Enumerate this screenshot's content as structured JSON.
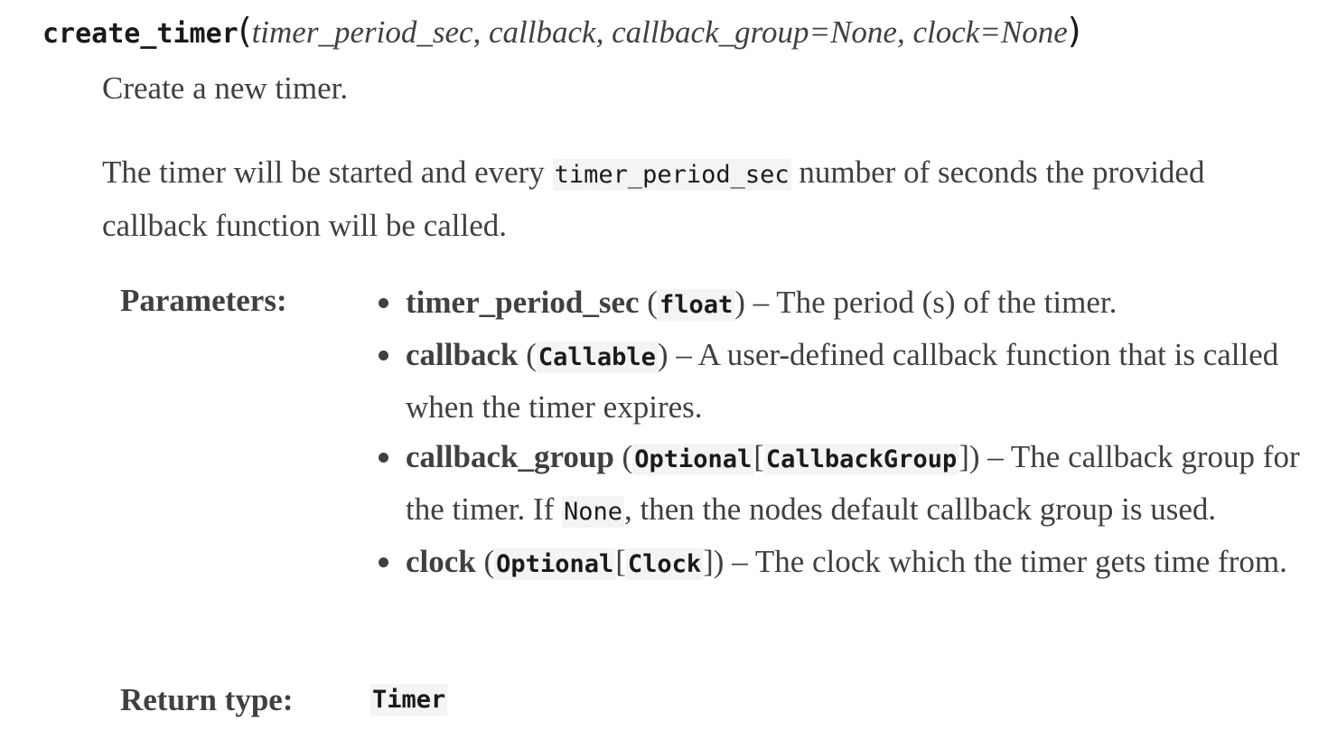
{
  "signature": {
    "name": "create_timer",
    "open_paren": "(",
    "params_text": "timer_period_sec, callback, callback_group=None, clock=None",
    "close_paren": ")"
  },
  "summary": "Create a new timer.",
  "description": {
    "before": "The timer will be started and every ",
    "code": "timer_period_sec",
    "after": " number of seconds the provided callback function will be called."
  },
  "parameters_label": "Parameters:",
  "parameters": [
    {
      "name": "timer_period_sec",
      "type_open": " (",
      "type_code": "float",
      "type_close": ")",
      "desc": " – The period (s) of the timer."
    },
    {
      "name": "callback",
      "type_open": " (",
      "type_code": "Callable",
      "type_close": ")",
      "desc": " – A user-defined callback function that is called when the timer expires."
    },
    {
      "name": "callback_group",
      "type_open": " (",
      "type_code": "Optional",
      "type_bracket_open": "[",
      "type_code2": "CallbackGroup",
      "type_close": "])",
      "desc_before": " – The callback group for the timer. If ",
      "desc_code": "None",
      "desc_after": ", then the nodes default callback group is used."
    },
    {
      "name": "clock",
      "type_open": " (",
      "type_code": "Optional",
      "type_bracket_open": "[",
      "type_code2": "Clock",
      "type_close": "])",
      "desc": " – The clock which the timer gets time from."
    }
  ],
  "return_type_label": "Return type:",
  "return_type": "Timer"
}
